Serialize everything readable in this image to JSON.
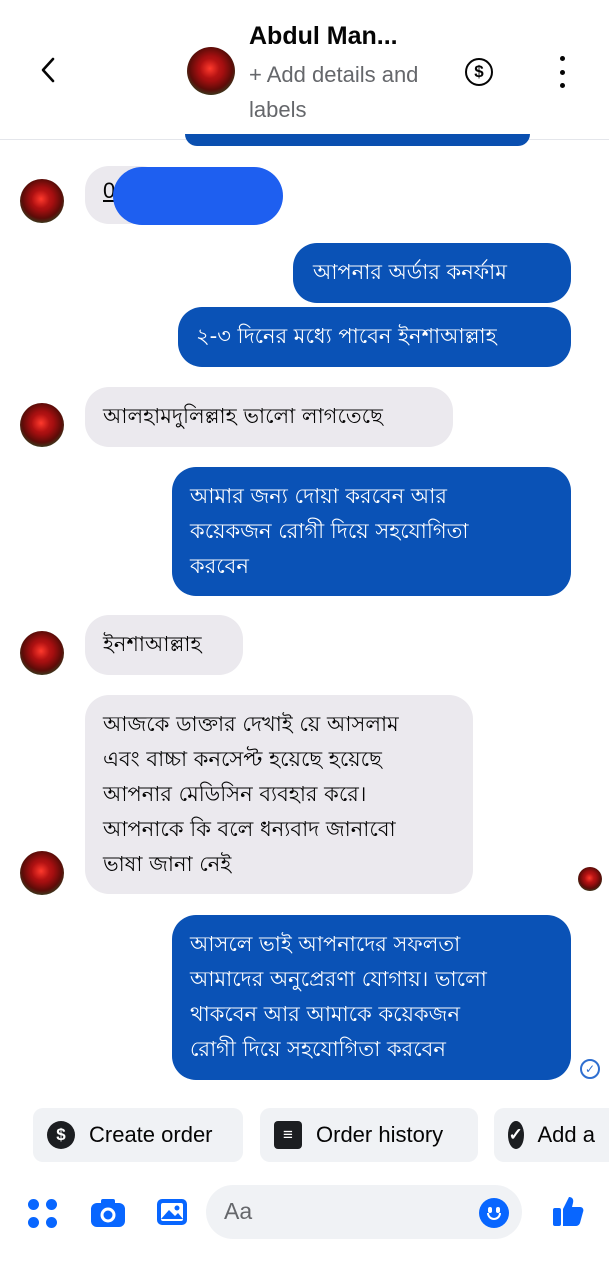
{
  "header": {
    "name": "Abdul Man...",
    "subtitle": "+ Add details and labels",
    "dollar_symbol": "$"
  },
  "messages": [
    {
      "side": "in",
      "text": "0"
    },
    {
      "side": "out",
      "text": "আপনার অর্ডার কনর্ফাম"
    },
    {
      "side": "out",
      "text": "২-৩ দিনের মধ্যে পাবেন ইনশাআল্লাহ"
    },
    {
      "side": "in",
      "text": "আলহামদুলিল্লাহ ভালো লাগতেছে"
    },
    {
      "side": "out",
      "lines": [
        "আমার জন্য দোয়া করবেন আর",
        "কয়েকজন রোগী দিয়ে সহযোগিতা",
        "করবেন"
      ]
    },
    {
      "side": "in",
      "text": "ইনশাআল্লাহ"
    },
    {
      "side": "in",
      "lines": [
        "আজকে ডাক্তার দেখাই য়ে আসলাম",
        "এবং বাচ্চা কনসেপ্ট হয়েছে হয়েছে",
        "আপনার মেডিসিন ব্যবহার করে।",
        "আপনাকে কি বলে ধন্যবাদ জানাবো",
        "ভাষা জানা নেই"
      ]
    },
    {
      "side": "out",
      "lines": [
        "আসলে ভাই আপনাদের সফলতা",
        "আমাদের অনুপ্রেরণা যোগায়। ভালো",
        "থাকবেন আর আমাকে কয়েকজন",
        "রোগী দিয়ে সহযোগিতা করবেন"
      ]
    }
  ],
  "quick_actions": [
    {
      "label": "Create order",
      "icon": "dollar-icon"
    },
    {
      "label": "Order history",
      "icon": "receipt-icon"
    },
    {
      "label": "Add a",
      "icon": "check-circle-icon"
    }
  ],
  "composer": {
    "placeholder": "Aa",
    "icons": [
      "apps-icon",
      "camera-icon",
      "gallery-icon",
      "emoji-icon",
      "like-icon"
    ]
  },
  "colors": {
    "outgoing_bubble": "#0a52b6",
    "incoming_bubble": "#ebe9ee",
    "accent": "#0866ff",
    "redaction": "#1e5ff0"
  }
}
